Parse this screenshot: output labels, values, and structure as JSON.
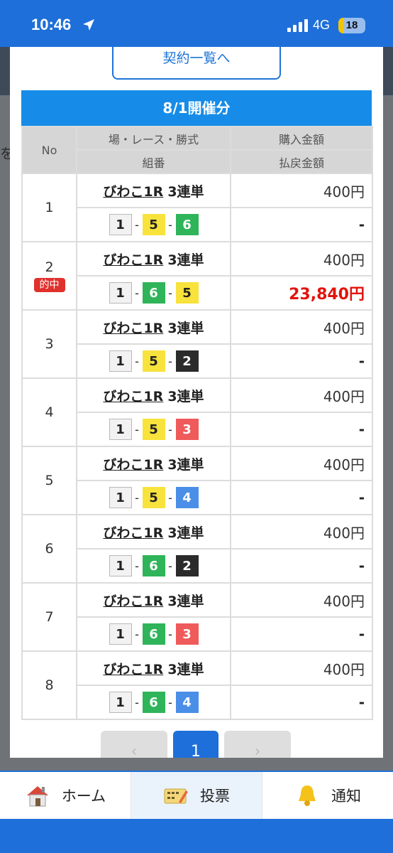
{
  "status_bar": {
    "time": "10:46",
    "network": "4G",
    "battery": "18",
    "location_icon": "location-arrow-icon",
    "signal_icon": "cellular-signal-icon"
  },
  "background": {
    "edge_text": "を"
  },
  "modal": {
    "contract_list_button": "契約一覧へ",
    "day_header": "8/1開催分",
    "table": {
      "headers": {
        "no": "No",
        "race_info": "場・レース・勝式",
        "combination": "組番",
        "purchase": "購入金額",
        "payout": "払戻金額"
      },
      "rows": [
        {
          "no": "1",
          "race": "びわこ1R",
          "bet_type": "3連単",
          "c1": "1",
          "c2": "5",
          "c3": "6",
          "amount": "400円",
          "payout": "-"
        },
        {
          "no": "2",
          "badge": "的中",
          "race": "びわこ1R",
          "bet_type": "3連単",
          "c1": "1",
          "c2": "6",
          "c3": "5",
          "amount": "400円",
          "payout": "23,840円"
        },
        {
          "no": "3",
          "race": "びわこ1R",
          "bet_type": "3連単",
          "c1": "1",
          "c2": "5",
          "c3": "2",
          "amount": "400円",
          "payout": "-"
        },
        {
          "no": "4",
          "race": "びわこ1R",
          "bet_type": "3連単",
          "c1": "1",
          "c2": "5",
          "c3": "3",
          "amount": "400円",
          "payout": "-"
        },
        {
          "no": "5",
          "race": "びわこ1R",
          "bet_type": "3連単",
          "c1": "1",
          "c2": "5",
          "c3": "4",
          "amount": "400円",
          "payout": "-"
        },
        {
          "no": "6",
          "race": "びわこ1R",
          "bet_type": "3連単",
          "c1": "1",
          "c2": "6",
          "c3": "2",
          "amount": "400円",
          "payout": "-"
        },
        {
          "no": "7",
          "race": "びわこ1R",
          "bet_type": "3連単",
          "c1": "1",
          "c2": "6",
          "c3": "3",
          "amount": "400円",
          "payout": "-"
        },
        {
          "no": "8",
          "race": "びわこ1R",
          "bet_type": "3連単",
          "c1": "1",
          "c2": "6",
          "c3": "4",
          "amount": "400円",
          "payout": "-"
        }
      ]
    },
    "pagination": {
      "prev": "‹",
      "current": "1",
      "next": "›"
    }
  },
  "tab_bar": {
    "home": "ホーム",
    "vote": "投票",
    "notify": "通知"
  },
  "boat_colors": {
    "1": {
      "bg": "#f2f2f2",
      "fg": "#222222",
      "border": "#b9b9b9"
    },
    "2": {
      "bg": "#2b2b2b",
      "fg": "#ffffff",
      "border": "#2b2b2b"
    },
    "3": {
      "bg": "#ef5a5a",
      "fg": "#ffffff",
      "border": "#ef5a5a"
    },
    "4": {
      "bg": "#4a8ee8",
      "fg": "#ffffff",
      "border": "#4a8ee8"
    },
    "5": {
      "bg": "#f8e23c",
      "fg": "#222222",
      "border": "#f8e23c"
    },
    "6": {
      "bg": "#2fb45a",
      "fg": "#ffffff",
      "border": "#2fb45a"
    }
  }
}
